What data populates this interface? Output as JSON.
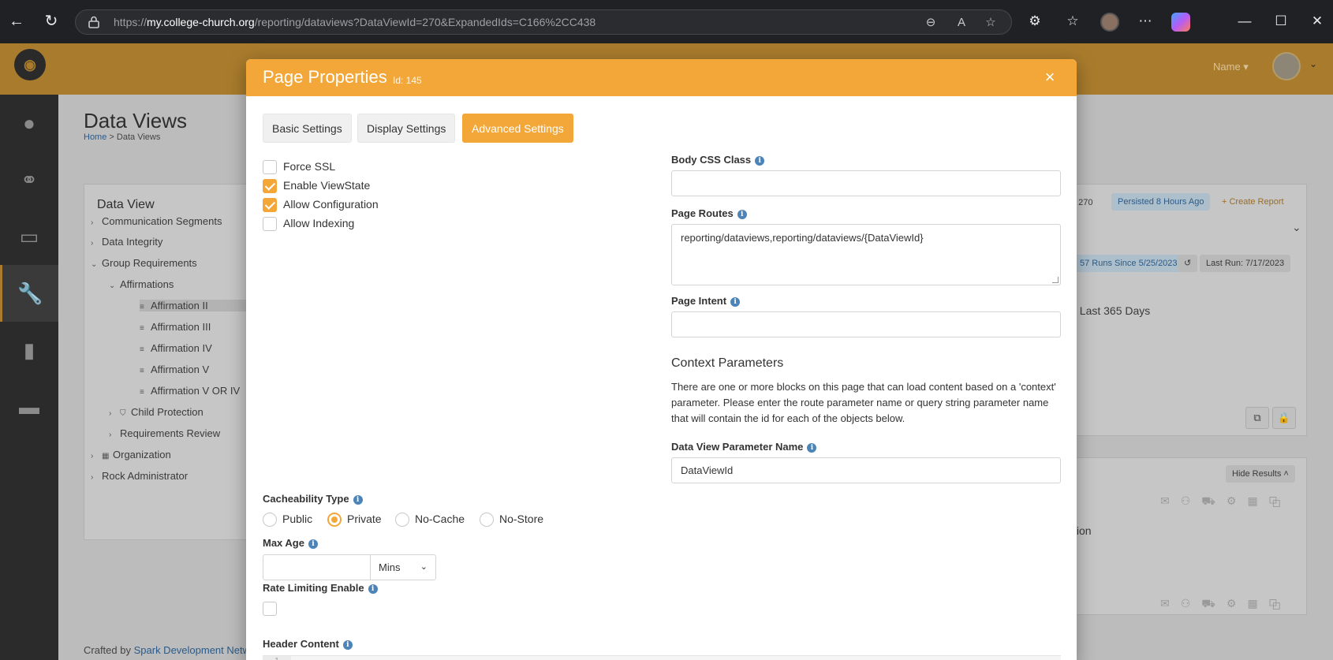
{
  "browser": {
    "url_scheme": "https://",
    "url_host": "my.college-church.org",
    "url_path": "/reporting/dataviews?DataViewId=270&ExpandedIds=C166%2CC438"
  },
  "app": {
    "user_menu": "Name",
    "page_title": "Data Views",
    "breadcrumb": {
      "home": "Home",
      "sep": ">",
      "current": "Data Views"
    },
    "tree_panel_title": "Data View",
    "tree": [
      {
        "label": "Communication Segments"
      },
      {
        "label": "Data Integrity"
      },
      {
        "label": "Group Requirements"
      },
      {
        "label": "Affirmations"
      },
      {
        "label": "Affirmation II"
      },
      {
        "label": "Affirmation III"
      },
      {
        "label": "Affirmation IV"
      },
      {
        "label": "Affirmation V"
      },
      {
        "label": "Affirmation V OR IV"
      },
      {
        "label": "Child Protection"
      },
      {
        "label": "Requirements Review"
      },
      {
        "label": "Organization"
      },
      {
        "label": "Rock Administrator"
      }
    ],
    "right_panel": {
      "id_text": ": 270",
      "persisted": "Persisted 8 Hours Ago",
      "create_report": "+ Create Report",
      "runs": "57 Runs Since 5/25/2023",
      "last_run": "Last Run: 7/17/2023",
      "filter_text": ": Last 365 Days",
      "hide_results": "Hide Results",
      "results_text": "tion"
    },
    "footer": {
      "prefix": "Crafted by",
      "link": "Spark Development Netwo"
    }
  },
  "modal": {
    "title": "Page Properties",
    "id_label": "Id: 145",
    "close_label": "×",
    "tabs": [
      {
        "label": "Basic Settings",
        "active": false
      },
      {
        "label": "Display Settings",
        "active": false
      },
      {
        "label": "Advanced Settings",
        "active": true
      }
    ],
    "checkboxes": [
      {
        "label": "Force SSL",
        "checked": false
      },
      {
        "label": "Enable ViewState",
        "checked": true
      },
      {
        "label": "Allow Configuration",
        "checked": true
      },
      {
        "label": "Allow Indexing",
        "checked": false
      }
    ],
    "body_css_class": {
      "label": "Body CSS Class",
      "value": ""
    },
    "page_routes": {
      "label": "Page Routes",
      "value": "reporting/dataviews,reporting/dataviews/{DataViewId}"
    },
    "page_intent": {
      "label": "Page Intent",
      "value": ""
    },
    "context_parameters": {
      "title": "Context Parameters",
      "description": "There are one or more blocks on this page that can load content based on a 'context' parameter. Please enter the route parameter name or query string parameter name that will contain the id for each of the objects below.",
      "param_label": "Data View Parameter Name",
      "param_value": "DataViewId"
    },
    "cacheability": {
      "label": "Cacheability Type",
      "options": [
        {
          "label": "Public",
          "checked": false
        },
        {
          "label": "Private",
          "checked": true
        },
        {
          "label": "No-Cache",
          "checked": false
        },
        {
          "label": "No-Store",
          "checked": false
        }
      ]
    },
    "max_age": {
      "label": "Max Age",
      "value": "",
      "unit": "Mins"
    },
    "rate_limiting": {
      "label": "Rate Limiting Enable",
      "checked": false
    },
    "header_content": {
      "label": "Header Content",
      "line_number": "1"
    }
  },
  "colors": {
    "accent": "#f2a738",
    "info": "#4d84b7",
    "chrome_bg": "#202124"
  }
}
